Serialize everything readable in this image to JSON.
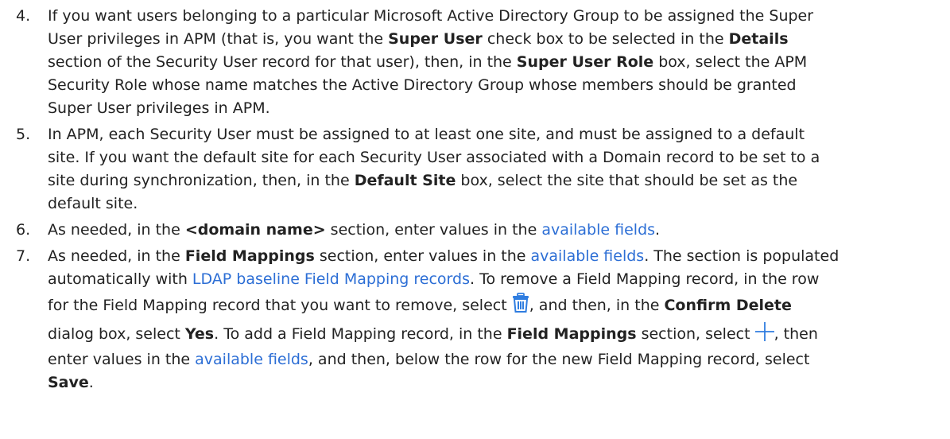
{
  "steps": [
    {
      "number": "4.",
      "lines": [
        [
          {
            "t": "If you want users belonging to a particular Microsoft Active Directory Group to be assigned the Super"
          }
        ],
        [
          {
            "t": "User privileges in APM (that is, you want the "
          },
          {
            "t": "Super User",
            "b": true
          },
          {
            "t": " check box to be selected in the "
          },
          {
            "t": "Details",
            "b": true
          }
        ],
        [
          {
            "t": "section of the Security User record for that user), then, in the "
          },
          {
            "t": "Super User Role",
            "b": true
          },
          {
            "t": " box, select the APM"
          }
        ],
        [
          {
            "t": "Security Role whose name matches the Active Directory Group whose members should be granted"
          }
        ],
        [
          {
            "t": "Super User privileges in APM."
          }
        ]
      ]
    },
    {
      "number": "5.",
      "lines": [
        [
          {
            "t": "In APM, each Security User must be assigned to at least one site, and must be assigned to a default"
          }
        ],
        [
          {
            "t": "site. If you want the default site for each Security User associated with a Domain record to be set to a"
          }
        ],
        [
          {
            "t": "site during synchronization, then, in the "
          },
          {
            "t": "Default Site",
            "b": true
          },
          {
            "t": " box, select the site that should be set as the"
          }
        ],
        [
          {
            "t": "default site."
          }
        ]
      ]
    },
    {
      "number": "6.",
      "lines": [
        [
          {
            "t": "As needed, in the "
          },
          {
            "t": "<domain name>",
            "b": true
          },
          {
            "t": " section, enter values in the "
          },
          {
            "t": "available fields",
            "link": true
          },
          {
            "t": "."
          }
        ]
      ]
    },
    {
      "number": "7.",
      "lines": [
        [
          {
            "t": "As needed, in the "
          },
          {
            "t": "Field Mappings",
            "b": true
          },
          {
            "t": " section, enter values in the "
          },
          {
            "t": "available fields",
            "link": true
          },
          {
            "t": ". The section is populated"
          }
        ],
        [
          {
            "t": "automatically with "
          },
          {
            "t": "LDAP baseline Field Mapping records",
            "link": true
          },
          {
            "t": ". To remove a Field Mapping record, in the row"
          }
        ],
        [
          {
            "t": "for the Field Mapping record that you want to remove, select "
          },
          {
            "icon": "trash-icon"
          },
          {
            "t": ", and then, in the "
          },
          {
            "t": "Confirm Delete",
            "b": true
          }
        ],
        [
          {
            "t": "dialog box, select "
          },
          {
            "t": "Yes",
            "b": true
          },
          {
            "t": ". To add a Field Mapping record, in the "
          },
          {
            "t": "Field Mappings",
            "b": true
          },
          {
            "t": " section, select "
          },
          {
            "icon": "plus-icon"
          },
          {
            "t": ", then"
          }
        ],
        [
          {
            "t": "enter values in the "
          },
          {
            "t": "available fields",
            "link": true
          },
          {
            "t": ", and then, below the row for the new Field Mapping record, select"
          }
        ],
        [
          {
            "t": "Save",
            "b": true
          },
          {
            "t": "."
          }
        ]
      ]
    }
  ],
  "colors": {
    "text": "#222222",
    "link": "#2c6ed5",
    "icon": "#2f7de0"
  }
}
